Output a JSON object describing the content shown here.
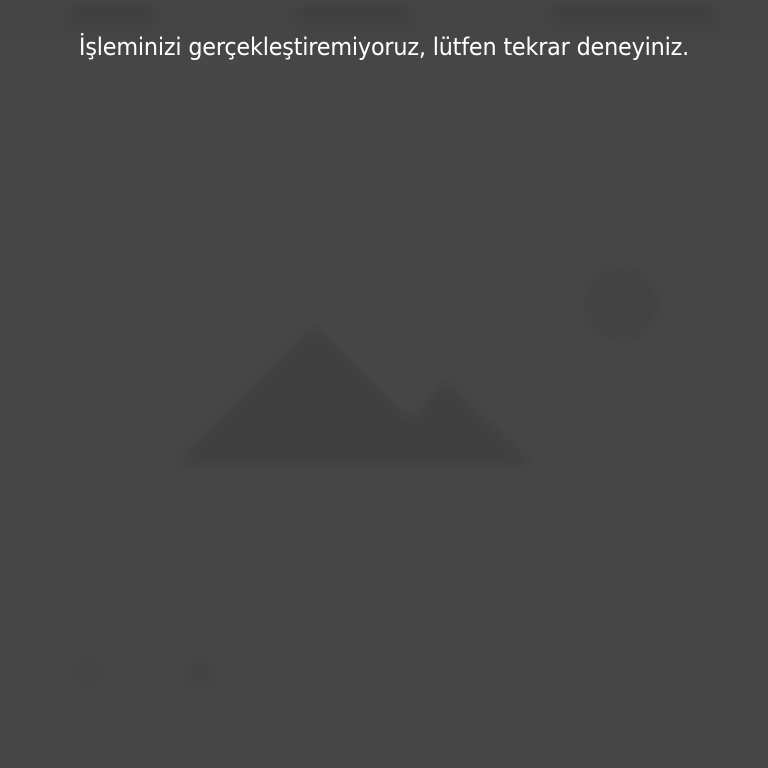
{
  "toast": {
    "message": "İşleminizi gerçekleştiremiyoruz, lütfen tekrar deneyiniz."
  },
  "colors": {
    "background": "#474747",
    "placeholder_shape": "#404040",
    "text": "#ffffff"
  },
  "icons": {
    "placeholder": "image-placeholder-icon",
    "bottom_left": "circle-icon",
    "bottom_right": "square-icon"
  }
}
